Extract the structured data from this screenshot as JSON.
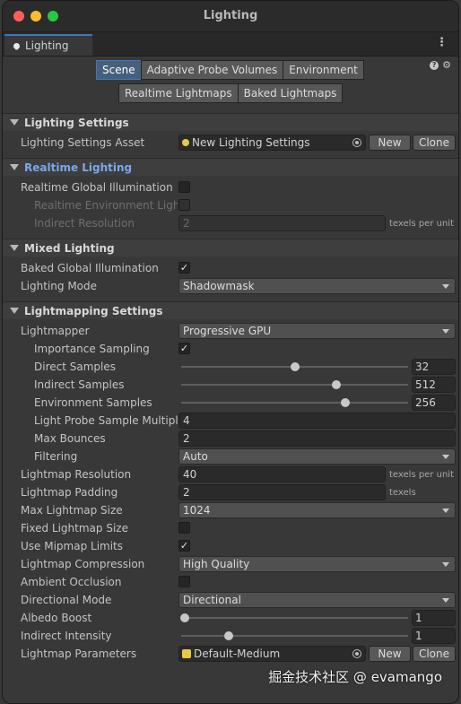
{
  "window": {
    "title": "Lighting"
  },
  "tab": {
    "label": "Lighting"
  },
  "toolbar": {
    "row1": [
      "Scene",
      "Adaptive Probe Volumes",
      "Environment"
    ],
    "row2": [
      "Realtime Lightmaps",
      "Baked Lightmaps"
    ],
    "active": "Scene"
  },
  "sections": {
    "lighting_settings": "Lighting Settings",
    "realtime_lighting": "Realtime Lighting",
    "mixed_lighting": "Mixed Lighting",
    "lightmapping_settings": "Lightmapping Settings"
  },
  "lighting_settings": {
    "asset_label": "Lighting Settings Asset",
    "asset_value": "New Lighting Settings",
    "new_label": "New",
    "clone_label": "Clone"
  },
  "realtime": {
    "rgi_label": "Realtime Global Illumination",
    "rgi_checked": false,
    "env_label": "Realtime Environment Lighting",
    "env_checked": false,
    "indirect_res_label": "Indirect Resolution",
    "indirect_res_value": "2",
    "indirect_res_unit": "texels per unit"
  },
  "mixed": {
    "bgi_label": "Baked Global Illumination",
    "bgi_checked": true,
    "mode_label": "Lighting Mode",
    "mode_value": "Shadowmask"
  },
  "lightmapping": {
    "lightmapper_label": "Lightmapper",
    "lightmapper_value": "Progressive GPU",
    "importance_label": "Importance Sampling",
    "importance_checked": true,
    "direct_label": "Direct Samples",
    "direct_value": "32",
    "direct_fraction": 0.5,
    "indirect_label": "Indirect Samples",
    "indirect_value": "512",
    "indirect_fraction": 0.69,
    "environment_label": "Environment Samples",
    "environment_value": "256",
    "environment_fraction": 0.73,
    "probe_mult_label": "Light Probe Sample Multiplier",
    "probe_mult_value": "4",
    "bounces_label": "Max Bounces",
    "bounces_value": "2",
    "filtering_label": "Filtering",
    "filtering_value": "Auto",
    "resolution_label": "Lightmap Resolution",
    "resolution_value": "40",
    "resolution_unit": "texels per unit",
    "padding_label": "Lightmap Padding",
    "padding_value": "2",
    "padding_unit": "texels",
    "max_size_label": "Max Lightmap Size",
    "max_size_value": "1024",
    "fixed_size_label": "Fixed Lightmap Size",
    "fixed_size_checked": false,
    "mipmap_label": "Use Mipmap Limits",
    "mipmap_checked": true,
    "compression_label": "Lightmap Compression",
    "compression_value": "High Quality",
    "ao_label": "Ambient Occlusion",
    "ao_checked": false,
    "directional_label": "Directional Mode",
    "directional_value": "Directional",
    "albedo_label": "Albedo Boost",
    "albedo_value": "1",
    "albedo_fraction": 0.0,
    "intensity_label": "Indirect Intensity",
    "intensity_value": "1",
    "intensity_fraction": 0.2,
    "params_label": "Lightmap Parameters",
    "params_value": "Default-Medium",
    "new_label": "New",
    "clone_label": "Clone"
  },
  "watermark": "掘金技术社区 @ evamango",
  "colors": {
    "accent": "#3a79bb",
    "section_blue": "#79a8ea"
  }
}
